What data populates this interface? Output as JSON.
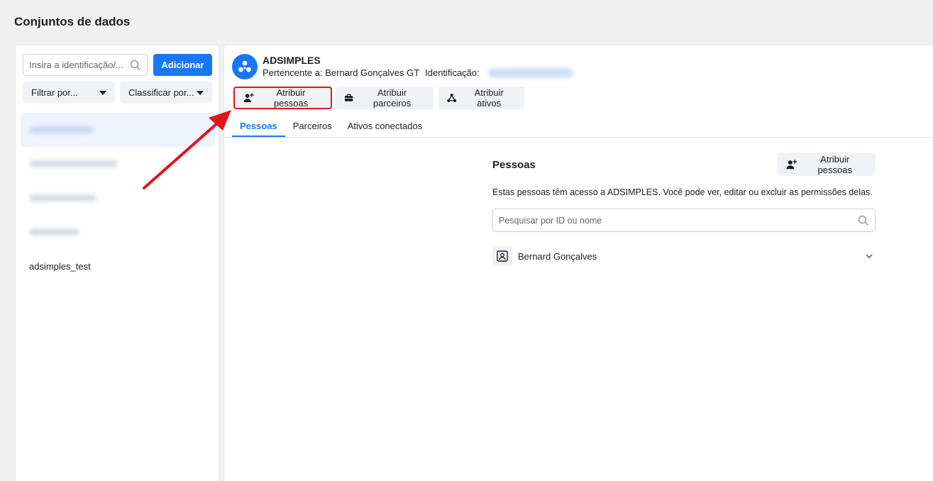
{
  "page": {
    "title": "Conjuntos de dados"
  },
  "left": {
    "search_placeholder": "Insira a identificação/...",
    "add_label": "Adicionar",
    "filter_label": "Filtrar por...",
    "sort_label": "Classificar por...",
    "datasets": [
      {
        "label": "adsimples_test"
      }
    ]
  },
  "asset": {
    "name": "ADSIMPLES",
    "owner_prefix": "Pertencente a:",
    "owner": "Bernard Gonçalves GT",
    "id_label": "Identificação:"
  },
  "actions": {
    "assign_people": "Atribuir pessoas",
    "assign_partners": "Atribuir parceiros",
    "assign_assets": "Atribuir ativos"
  },
  "tabs": [
    {
      "label": "Pessoas"
    },
    {
      "label": "Parceiros"
    },
    {
      "label": "Ativos conectados"
    }
  ],
  "people": {
    "title": "Pessoas",
    "assign_label": "Atribuir pessoas",
    "description": "Estas pessoas têm acesso a ADSIMPLES. Você pode ver, editar ou excluir as permissões delas.",
    "search_placeholder": "Pesquisar por ID ou nome",
    "list": [
      {
        "name": "Bernard Gonçalves"
      }
    ]
  },
  "colors": {
    "accent": "#1877f2",
    "annotation": "#e0161b"
  }
}
